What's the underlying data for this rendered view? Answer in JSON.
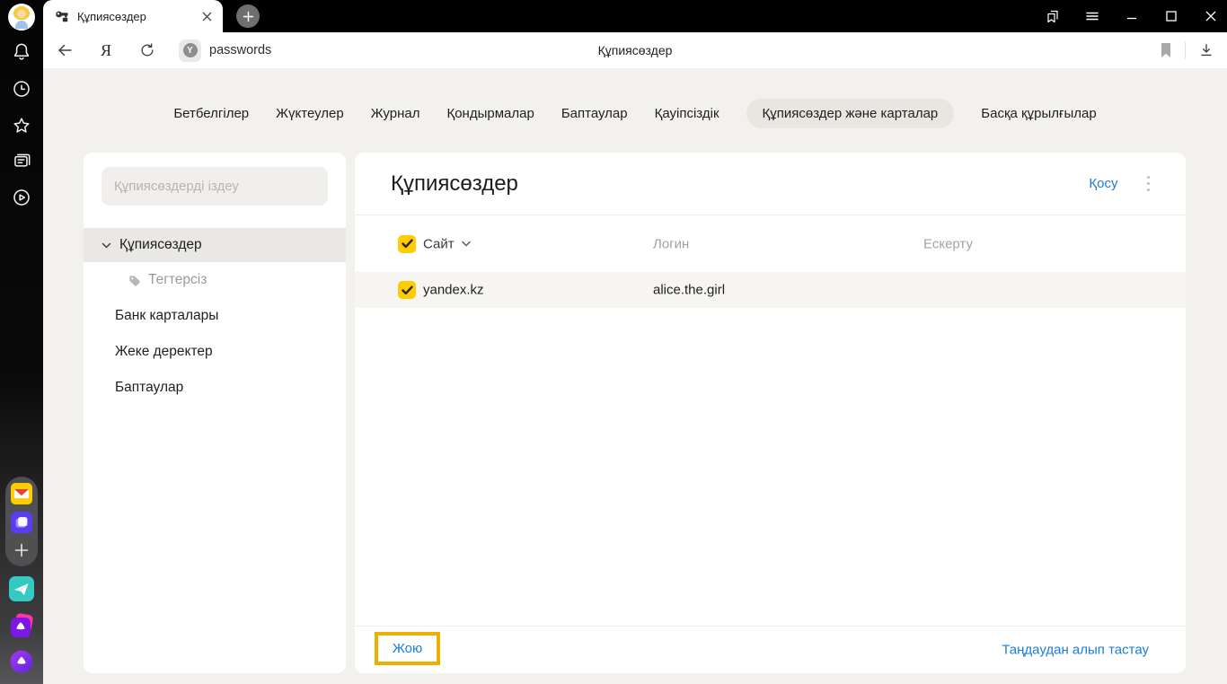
{
  "window": {
    "tab_title": "Құпиясөздер"
  },
  "address_bar": {
    "yandex_logo": "Я",
    "badge_letter": "Y",
    "url_text": "passwords",
    "page_title": "Құпиясөздер"
  },
  "settings_nav": {
    "items": [
      {
        "label": "Бетбелгілер",
        "selected": false
      },
      {
        "label": "Жүктеулер",
        "selected": false
      },
      {
        "label": "Журнал",
        "selected": false
      },
      {
        "label": "Қондырмалар",
        "selected": false
      },
      {
        "label": "Баптаулар",
        "selected": false
      },
      {
        "label": "Қауіпсіздік",
        "selected": false
      },
      {
        "label": "Құпиясөздер және карталар",
        "selected": true
      },
      {
        "label": "Басқа құрылғылар",
        "selected": false
      }
    ]
  },
  "sidebar": {
    "search_placeholder": "Құпиясөздерді іздеу",
    "items": [
      {
        "label": "Құпиясөздер",
        "selected": true,
        "expanded": true
      },
      {
        "label": "Тегтерсіз",
        "child": true
      },
      {
        "label": "Банк карталары"
      },
      {
        "label": "Жеке деректер"
      },
      {
        "label": "Баптаулар"
      }
    ]
  },
  "main": {
    "title": "Құпиясөздер",
    "add_button": "Қосу",
    "table": {
      "columns": {
        "site": "Сайт",
        "login": "Логин",
        "note": "Ескерту"
      },
      "header_checkbox_checked": true,
      "rows": [
        {
          "site": "yandex.kz",
          "login": "alice.the.girl",
          "note": "",
          "checked": true,
          "selected": true
        }
      ]
    },
    "footer": {
      "delete_button": "Жою",
      "deselect_link": "Таңдаудан алып тастау"
    }
  },
  "colors": {
    "accent_blue": "#1b7cd6",
    "yandex_yellow": "#ffcc00",
    "highlight_border": "#eeb000",
    "selected_row": "#f6f5f2",
    "page_background": "#f2f1ee"
  }
}
